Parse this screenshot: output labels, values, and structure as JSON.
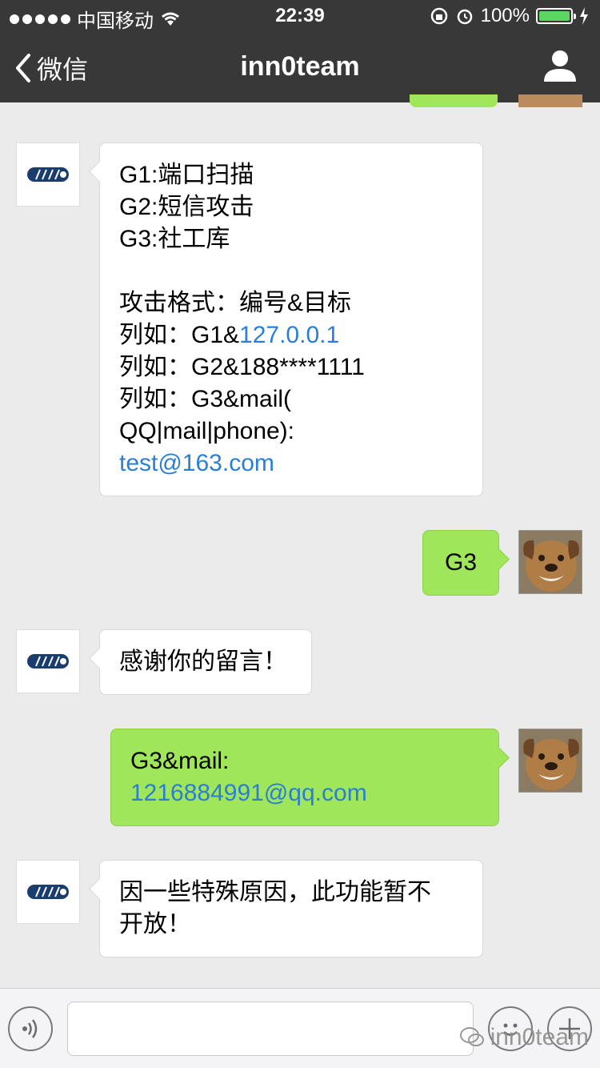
{
  "status_bar": {
    "carrier": "中国移动",
    "time": "22:39",
    "battery": "100%"
  },
  "nav": {
    "back_label": "微信",
    "title": "inn0team"
  },
  "messages": [
    {
      "type": "in",
      "lines": [
        "G1:端口扫描",
        "G2:短信攻击",
        "G3:社工库",
        "",
        "攻击格式：编号&目标"
      ],
      "ex1_prefix": "列如：G1&",
      "ex1_link": "127.0.0.1",
      "ex2": "列如：G2&188****1111",
      "ex3a": "列如：G3&mail(",
      "ex3b": "QQ|mail|phone):",
      "ex3_link": "test@163.com"
    },
    {
      "type": "out",
      "text": "G3"
    },
    {
      "type": "in",
      "text": "感谢你的留言！"
    },
    {
      "type": "out",
      "line1": "G3&mail:",
      "link": "1216884991@qq.com"
    },
    {
      "type": "in",
      "line1": "因一些特殊原因，此功能暂不",
      "line2": "开放！"
    }
  ],
  "watermark": "inn0team",
  "icons": {
    "back": "chevron-left-icon",
    "profile": "person-icon",
    "voice": "voice-icon",
    "emoji": "emoji-icon",
    "add": "plus-icon"
  }
}
